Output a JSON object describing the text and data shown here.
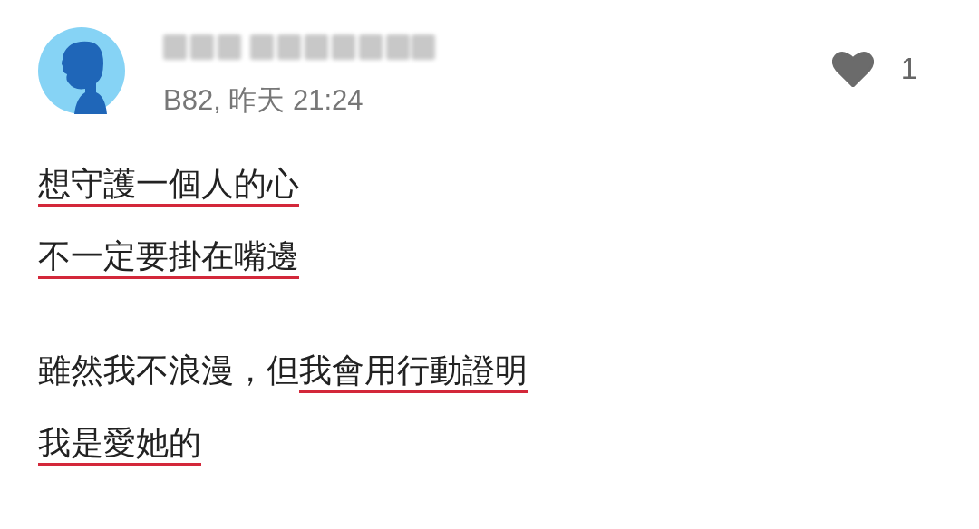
{
  "comment": {
    "author": {
      "kind": "blurred"
    },
    "meta": "B82, 昨天 21:24",
    "likes": "1",
    "liked": true,
    "paragraphs": [
      [
        [
          {
            "text": "想守護一個人的心",
            "underlined": true
          }
        ],
        [
          {
            "text": "不一定要掛在嘴邊",
            "underlined": true
          }
        ]
      ],
      [
        [
          {
            "text": "雖然我不浪漫，但",
            "underlined": false
          },
          {
            "text": "我會用行動證明",
            "underlined": true
          }
        ],
        [
          {
            "text": "我是愛她的",
            "underlined": true
          }
        ]
      ]
    ]
  }
}
